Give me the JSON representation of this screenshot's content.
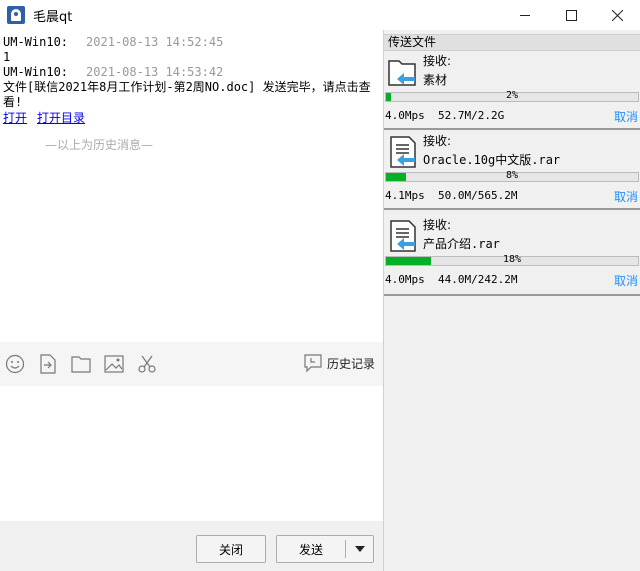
{
  "window": {
    "title": "毛晨qt",
    "icon": "app-logo-icon",
    "controls": [
      "minimize-icon",
      "maximize-icon",
      "close-icon"
    ]
  },
  "chat": {
    "messages": [
      {
        "sender": "UM-Win10:",
        "time": "2021-08-13 14:52:45",
        "text": "1"
      },
      {
        "sender": "UM-Win10:",
        "time": "2021-08-13 14:53:42",
        "text": "文件[联信2021年8月工作计划-第2周NO.doc] 发送完毕，请点击查看!"
      }
    ],
    "links": {
      "open": "打开",
      "open_folder": "打开目录"
    },
    "history_note": "—以上为历史消息—"
  },
  "toolbar": {
    "icons": [
      "emoji-icon",
      "send-file-icon",
      "folder-icon",
      "image-icon",
      "screenshot-scissors-icon"
    ],
    "history_label": "历史记录",
    "history_icon": "history-speech-icon"
  },
  "buttons": {
    "close_label": "关闭",
    "send_label": "发送"
  },
  "transfer_panel": {
    "title": "传送文件",
    "items": [
      {
        "icon": "folder-receive-icon",
        "status": "接收:",
        "name": "素材",
        "percent_label": "2%",
        "progress": 2,
        "speed": "4.0Mps",
        "size": "52.7M/2.2G",
        "cancel": "取消"
      },
      {
        "icon": "document-receive-icon",
        "status": "接收:",
        "name": "Oracle.10g中文版.rar",
        "percent_label": "8%",
        "progress": 8,
        "speed": "4.1Mps",
        "size": "50.0M/565.2M",
        "cancel": "取消"
      },
      {
        "icon": "document-receive-icon",
        "status": "接收:",
        "name": "产品介绍.rar",
        "percent_label": "18%",
        "progress": 18,
        "speed": "4.0Mps",
        "size": "44.0M/242.2M",
        "cancel": "取消"
      }
    ]
  },
  "colors": {
    "progress_fill": "#06b025",
    "cancel_link": "#1e90ff",
    "timestamp": "#999999",
    "link": "#0000ee"
  }
}
